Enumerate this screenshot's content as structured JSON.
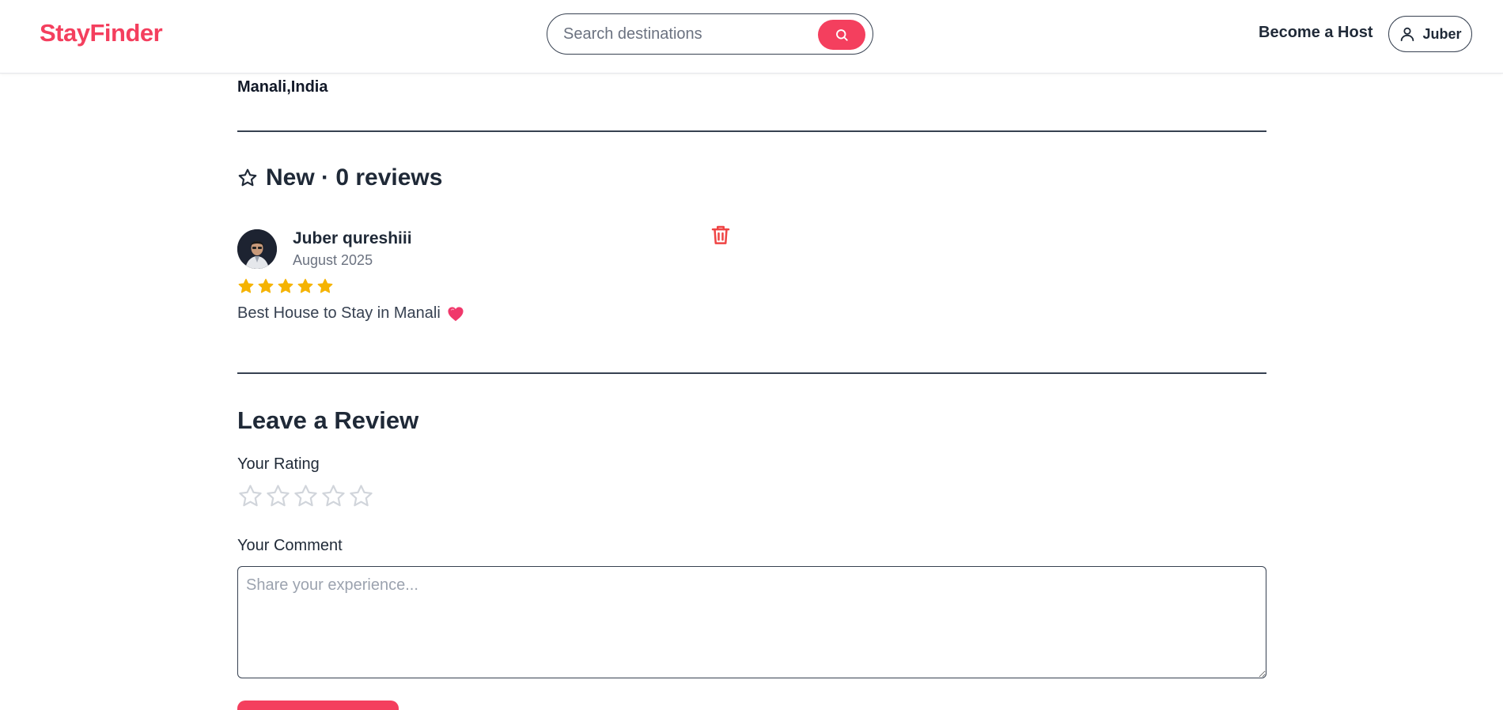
{
  "header": {
    "logo": "StayFinder",
    "search_placeholder": "Search destinations",
    "become_host": "Become a Host",
    "user_name": "Juber"
  },
  "listing": {
    "location": "Manali,India"
  },
  "reviews": {
    "heading": "New · 0 reviews",
    "items": [
      {
        "name": "Juber qureshiii",
        "date": "August 2025",
        "rating": 5,
        "text": "Best House to Stay in Manali",
        "emoji": "💗"
      }
    ]
  },
  "review_form": {
    "heading": "Leave a Review",
    "rating_label": "Your Rating",
    "rating_value": 0,
    "comment_label": "Your Comment",
    "comment_placeholder": "Share your experience..."
  },
  "colors": {
    "accent": "#f43f5e",
    "star_filled": "#f5b301",
    "star_empty": "#d1d5db",
    "text_dark": "#1f2937"
  }
}
